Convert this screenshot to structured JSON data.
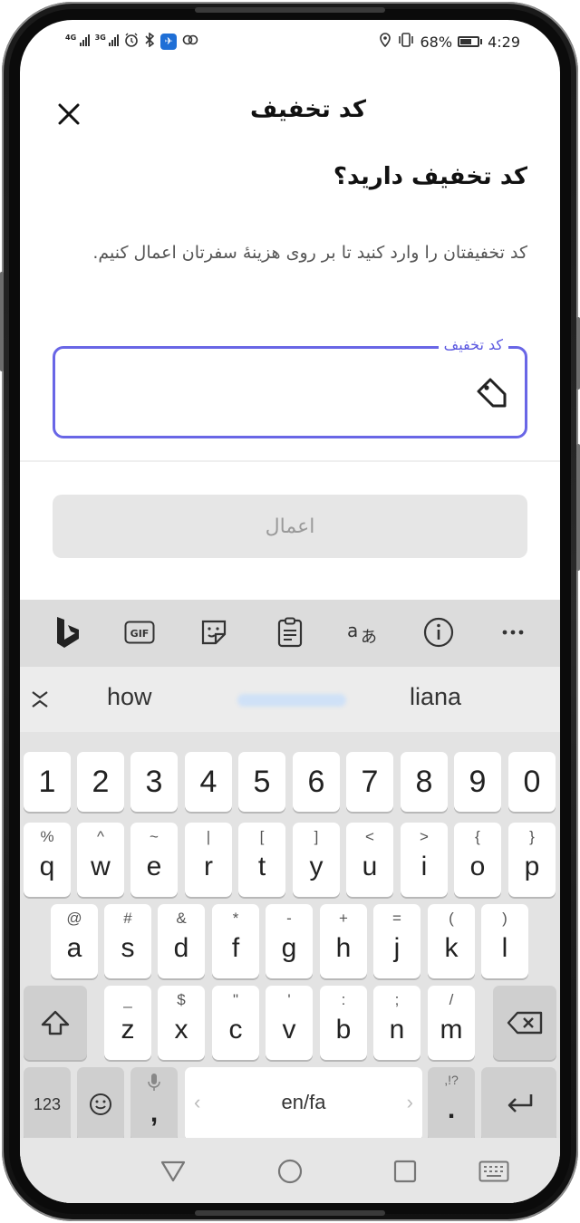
{
  "status_bar": {
    "net1": "4G",
    "net2": "3G",
    "battery_percent": "68%",
    "battery_level": 0.68,
    "time": "4:29",
    "icons": [
      "signal-icon",
      "signal-icon",
      "alarm-icon",
      "bluetooth-icon",
      "app-icon",
      "sync-icon",
      "location-icon",
      "vibrate-icon",
      "battery-icon"
    ]
  },
  "header": {
    "title": "کد تخفیف",
    "close_icon": "close-icon"
  },
  "content": {
    "question": "کد تخفیف دارید؟",
    "description": "کد تخفیفتان را وارد کنید تا بر روی هزینهٔ سفرتان اعمال کنیم.",
    "coupon_field": {
      "label": "کد تخفیف",
      "value": "",
      "icon": "tag-icon"
    },
    "apply_button": "اعمال"
  },
  "keyboard": {
    "toolbar_icons": [
      "bing-icon",
      "gif-icon",
      "sticker-icon",
      "clipboard-icon",
      "translate-icon",
      "info-icon",
      "more-icon"
    ],
    "suggestions": [
      "how",
      "liana"
    ],
    "number_row": [
      "1",
      "2",
      "3",
      "4",
      "5",
      "6",
      "7",
      "8",
      "9",
      "0"
    ],
    "row1": [
      {
        "main": "q",
        "sec": "%"
      },
      {
        "main": "w",
        "sec": "^"
      },
      {
        "main": "e",
        "sec": "~"
      },
      {
        "main": "r",
        "sec": "|"
      },
      {
        "main": "t",
        "sec": "["
      },
      {
        "main": "y",
        "sec": "]"
      },
      {
        "main": "u",
        "sec": "<"
      },
      {
        "main": "i",
        "sec": ">"
      },
      {
        "main": "o",
        "sec": "{"
      },
      {
        "main": "p",
        "sec": "}"
      }
    ],
    "row2": [
      {
        "main": "a",
        "sec": "@"
      },
      {
        "main": "s",
        "sec": "#"
      },
      {
        "main": "d",
        "sec": "&"
      },
      {
        "main": "f",
        "sec": "*"
      },
      {
        "main": "g",
        "sec": "-"
      },
      {
        "main": "h",
        "sec": "+"
      },
      {
        "main": "j",
        "sec": "="
      },
      {
        "main": "k",
        "sec": "("
      },
      {
        "main": "l",
        "sec": ")"
      }
    ],
    "row3": [
      {
        "main": "z",
        "sec": "_"
      },
      {
        "main": "x",
        "sec": "$"
      },
      {
        "main": "c",
        "sec": "\""
      },
      {
        "main": "v",
        "sec": "'"
      },
      {
        "main": "b",
        "sec": ":"
      },
      {
        "main": "n",
        "sec": ";"
      },
      {
        "main": "m",
        "sec": "/"
      }
    ],
    "bottom": {
      "numbers_label": "123",
      "comma": ",",
      "space_label": "en/fa",
      "space_left_arrow": "‹",
      "space_right_arrow": "›",
      "period": ".",
      "period_sec": ",!?"
    }
  },
  "navbar": {
    "icons": [
      "back-icon",
      "home-icon",
      "recents-icon",
      "keyboard-icon"
    ]
  }
}
